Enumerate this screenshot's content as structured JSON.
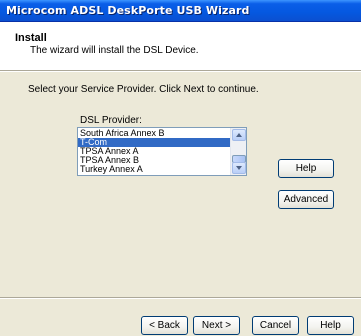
{
  "window": {
    "title": "Microcom ADSL DeskPorte USB Wizard"
  },
  "header": {
    "title": "Install",
    "subtitle": "The wizard will install the DSL Device."
  },
  "main": {
    "instruction": "Select your Service Provider. Click Next to continue.",
    "dsl_label": "DSL Provider:",
    "providers": [
      "South Africa Annex B",
      "T-Com",
      "TPSA Annex A",
      "TPSA Annex B",
      "Turkey Annex A"
    ],
    "selected_provider": "T-Com",
    "help_label": "Help",
    "advanced_label": "Advanced"
  },
  "footer": {
    "back_label": "< Back",
    "next_label": "Next >",
    "cancel_label": "Cancel",
    "help_label": "Help"
  },
  "colors": {
    "titlebar": "#0558e0",
    "dialog_bg": "#ece9d8",
    "selection": "#316ac5",
    "button_border": "#003c74"
  }
}
